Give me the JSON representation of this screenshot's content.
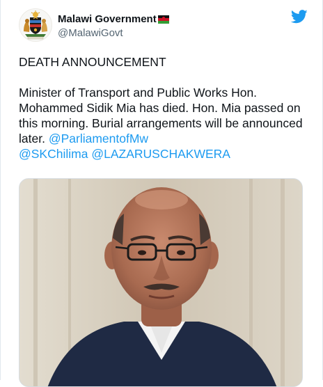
{
  "account": {
    "display_name": "Malawi Government",
    "handle": "@MalawiGovt",
    "avatar_icon": "malawi-coat-of-arms-icon",
    "flag_icon": "malawi-flag-icon",
    "platform_icon": "twitter-bird-icon"
  },
  "tweet": {
    "heading": "DEATH ANNOUNCEMENT",
    "body": "Minister of Transport and Public Works Hon. Mohammed Sidik Mia has died. Hon. Mia passed on this morning. Burial arrangements will be announced later.",
    "mentions": [
      "@ParliamentofMw",
      "@SKChilima",
      "@LAZARUSCHAKWERA"
    ]
  },
  "media": {
    "photo_icon": "portrait-photo"
  },
  "colors": {
    "link": "#1d9bf0",
    "text": "#0f1419",
    "secondary_text": "#536471",
    "twitter_blue": "#1d9bf0"
  }
}
